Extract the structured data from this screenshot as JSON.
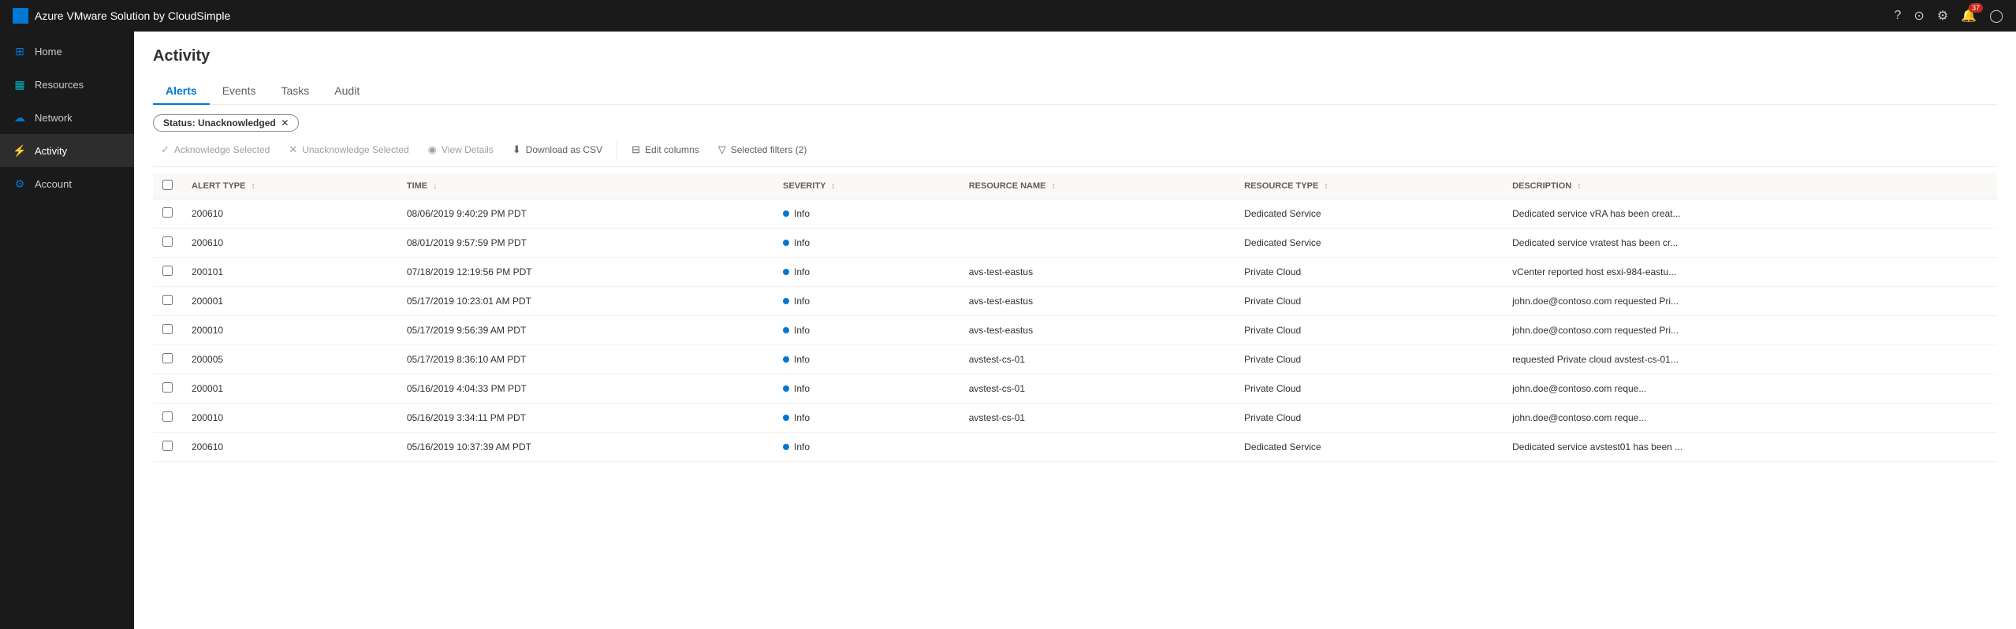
{
  "app": {
    "title": "Azure VMware Solution by CloudSimple"
  },
  "topbar": {
    "icons": {
      "help": "?",
      "user_circle": "👤",
      "settings": "⚙",
      "notifications": "🔔",
      "notification_count": "37",
      "profile": "👤"
    }
  },
  "sidebar": {
    "items": [
      {
        "id": "home",
        "label": "Home",
        "icon": "⊞",
        "active": false
      },
      {
        "id": "resources",
        "label": "Resources",
        "icon": "▦",
        "active": false
      },
      {
        "id": "network",
        "label": "Network",
        "icon": "☁",
        "active": false
      },
      {
        "id": "activity",
        "label": "Activity",
        "icon": "⚡",
        "active": true
      },
      {
        "id": "account",
        "label": "Account",
        "icon": "⚙",
        "active": false
      }
    ]
  },
  "page": {
    "title": "Activity"
  },
  "tabs": [
    {
      "id": "alerts",
      "label": "Alerts",
      "active": true
    },
    {
      "id": "events",
      "label": "Events",
      "active": false
    },
    {
      "id": "tasks",
      "label": "Tasks",
      "active": false
    },
    {
      "id": "audit",
      "label": "Audit",
      "active": false
    }
  ],
  "status_filter": {
    "label": "Status:",
    "value": "Unacknowledged"
  },
  "toolbar": {
    "acknowledge_selected": "Acknowledge Selected",
    "unacknowledge_selected": "Unacknowledge Selected",
    "view_details": "View Details",
    "download_csv": "Download as CSV",
    "edit_columns": "Edit columns",
    "selected_filters": "Selected filters (2)"
  },
  "table": {
    "columns": [
      {
        "id": "alert_type",
        "label": "ALERT TYPE"
      },
      {
        "id": "time",
        "label": "TIME"
      },
      {
        "id": "severity",
        "label": "SEVERITY"
      },
      {
        "id": "resource_name",
        "label": "RESOURCE NAME"
      },
      {
        "id": "resource_type",
        "label": "RESOURCE TYPE"
      },
      {
        "id": "description",
        "label": "DESCRIPTION"
      }
    ],
    "rows": [
      {
        "alert_type": "200610",
        "time": "08/06/2019 9:40:29 PM PDT",
        "severity": "Info",
        "resource_name": "",
        "resource_type": "Dedicated Service",
        "description": "Dedicated service vRA has been creat..."
      },
      {
        "alert_type": "200610",
        "time": "08/01/2019 9:57:59 PM PDT",
        "severity": "Info",
        "resource_name": "",
        "resource_type": "Dedicated Service",
        "description": "Dedicated service vratest has been cr..."
      },
      {
        "alert_type": "200101",
        "time": "07/18/2019 12:19:56 PM PDT",
        "severity": "Info",
        "resource_name": "avs-test-eastus",
        "resource_type": "Private Cloud",
        "description": "vCenter reported host esxi-984-eastu..."
      },
      {
        "alert_type": "200001",
        "time": "05/17/2019 10:23:01 AM PDT",
        "severity": "Info",
        "resource_name": "avs-test-eastus",
        "resource_type": "Private Cloud",
        "description": "john.doe@contoso.com requested Pri..."
      },
      {
        "alert_type": "200010",
        "time": "05/17/2019 9:56:39 AM PDT",
        "severity": "Info",
        "resource_name": "avs-test-eastus",
        "resource_type": "Private Cloud",
        "description": "john.doe@contoso.com requested Pri..."
      },
      {
        "alert_type": "200005",
        "time": "05/17/2019 8:36:10 AM PDT",
        "severity": "Info",
        "resource_name": "avstest-cs-01",
        "resource_type": "Private Cloud",
        "description": "requested Private cloud avstest-cs-01..."
      },
      {
        "alert_type": "200001",
        "time": "05/16/2019 4:04:33 PM PDT",
        "severity": "Info",
        "resource_name": "avstest-cs-01",
        "resource_type": "Private Cloud",
        "description": "john.doe@contoso.com  reque..."
      },
      {
        "alert_type": "200010",
        "time": "05/16/2019 3:34:11 PM PDT",
        "severity": "Info",
        "resource_name": "avstest-cs-01",
        "resource_type": "Private Cloud",
        "description": "john.doe@contoso.com  reque..."
      },
      {
        "alert_type": "200610",
        "time": "05/16/2019 10:37:39 AM PDT",
        "severity": "Info",
        "resource_name": "",
        "resource_type": "Dedicated Service",
        "description": "Dedicated service avstest01 has been ..."
      }
    ]
  }
}
